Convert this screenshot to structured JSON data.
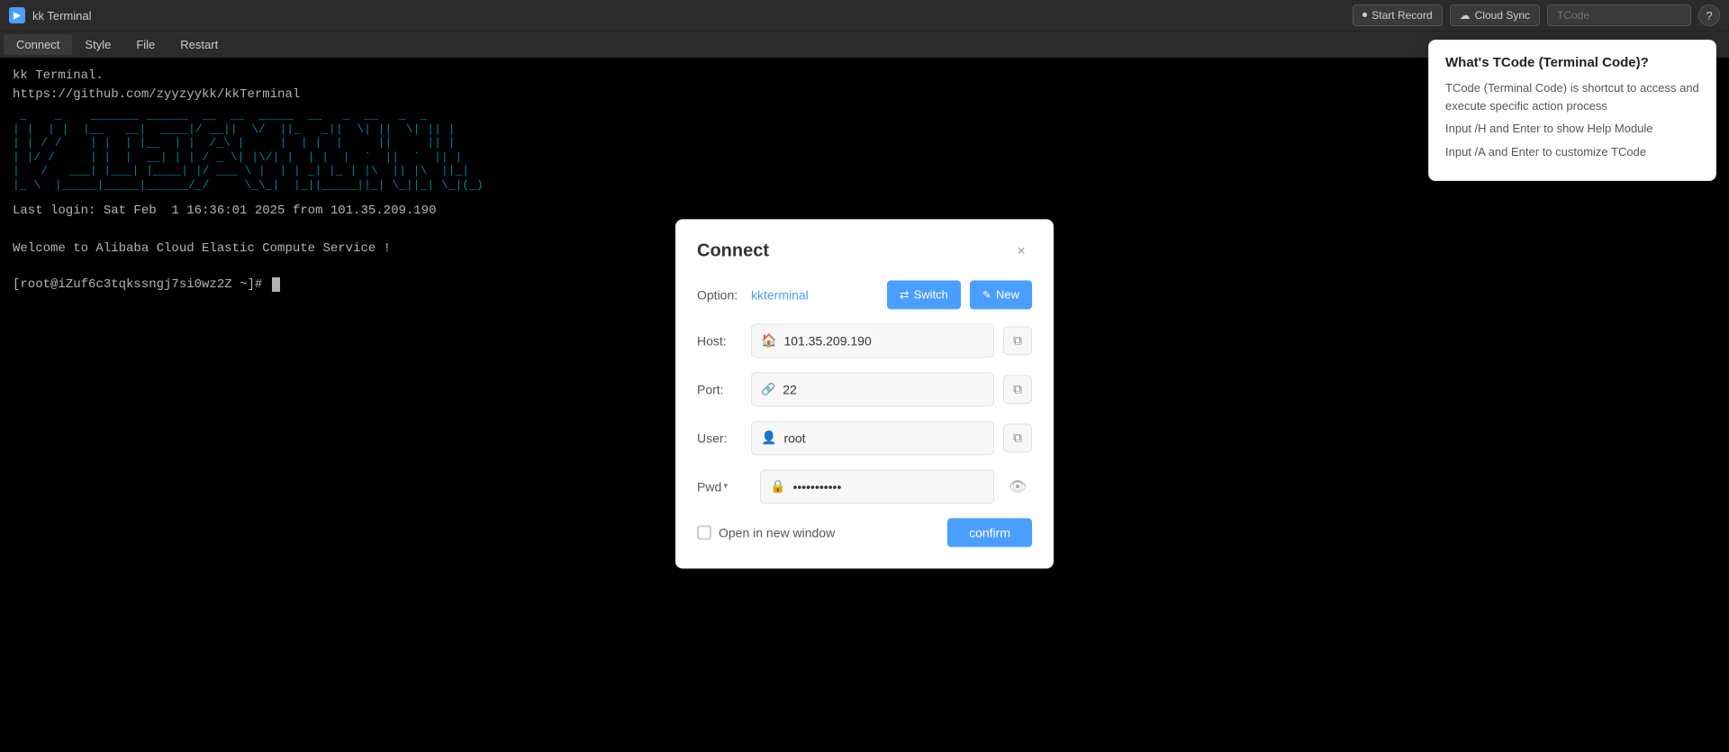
{
  "titlebar": {
    "icon": "▶",
    "title": "kk Terminal",
    "start_record_label": "Start Record",
    "cloud_sync_label": "Cloud Sync",
    "tcode_placeholder": "TCode",
    "help_icon": "?"
  },
  "menubar": {
    "items": [
      {
        "label": "Connect"
      },
      {
        "label": "Style"
      },
      {
        "label": "File"
      },
      {
        "label": "Restart"
      }
    ]
  },
  "terminal": {
    "ascii_art": "kk Terminal.\nhttps://github.com/zyyzyykk/kkTerminal\n\n _     _    _______ __   _____  ____  ____  __  _   __   _\n| |/ /| |/ /|__   __/ /  / ____|/ __ \\|  _ \\|  \\| | /  \\ | |\n|   / |   /    | | | |  | |    | |  | | |_) |   ` |/ /\\ \\| |\n|  \\  |  \\     | | | |__| |____| |__| |  _ <| |\\  / ____ \\ |\n|_|\\_\\|_|\\_\\   |_|  \\____\\_____|\\____/|_| \\_\\_| \\_/_/    \\_|",
    "lines": [
      "Last login: Sat Feb  1 16:36:01 2025 from 101.35.209.190",
      "",
      "Welcome to Alibaba Cloud Elastic Compute Service !",
      "",
      "[root@iZuf6c3tqkssngj7si0wz2Z ~]# "
    ]
  },
  "dialog": {
    "title": "Connect",
    "close_icon": "×",
    "option_label": "Option:",
    "option_value": "kkterminal",
    "switch_label": "Switch",
    "new_label": "New",
    "host_label": "Host:",
    "host_value": "101.35.209.190",
    "port_label": "Port:",
    "port_value": "22",
    "user_label": "User:",
    "user_value": "root",
    "pwd_label": "Pwd",
    "pwd_value": "••••••••••",
    "open_new_window_label": "Open in new window",
    "confirm_label": "confirm"
  },
  "tcode_tooltip": {
    "title": "What's TCode (Terminal Code)?",
    "lines": [
      "TCode (Terminal Code) is shortcut to access and execute specific action process",
      "Input /H and Enter to show Help Module",
      "Input /A and Enter to customize TCode"
    ]
  }
}
